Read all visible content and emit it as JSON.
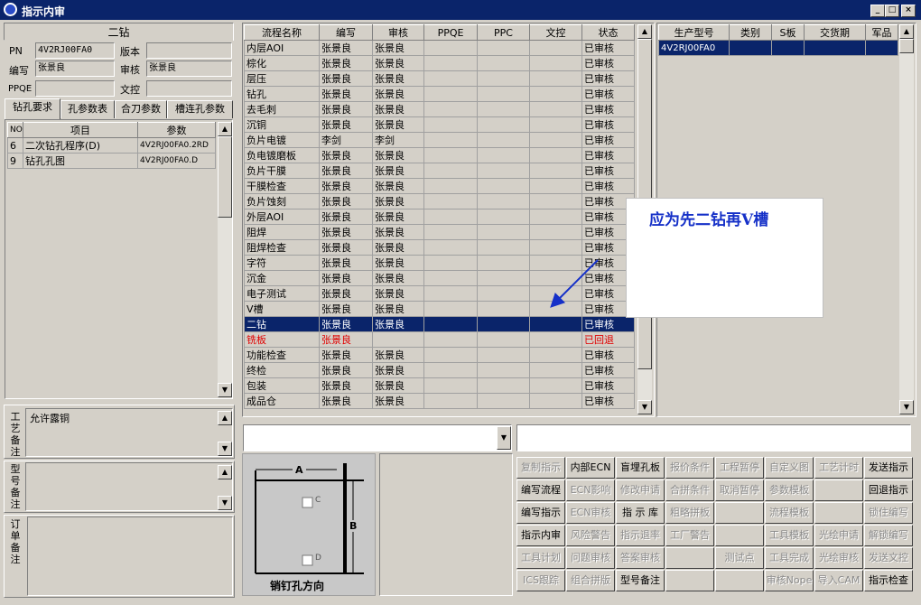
{
  "window": {
    "title": "指示内审",
    "min": "_",
    "max": "□",
    "close": "×"
  },
  "left": {
    "heading": "二钻",
    "pn_label": "PN",
    "pn_value": "4V2RJ00FA0",
    "version_label": "版本",
    "version_value": "",
    "writer_label": "编写",
    "writer_value": "张景良",
    "reviewer_label": "审核",
    "reviewer_value": "张景良",
    "ppqe_label": "PPQE",
    "ppqe_value": "",
    "doc_label": "文控",
    "doc_value": "",
    "tabs": [
      "钻孔要求",
      "孔参数表",
      "合刀参数",
      "槽连孔参数"
    ],
    "drill_table": {
      "headers": [
        "NO",
        "项目",
        "参数"
      ],
      "rows": [
        [
          "6",
          "二次钻孔程序(D)",
          "4V2RJ00FA0.2RD"
        ],
        [
          "9",
          "钻孔孔图",
          "4V2RJ00FA0.D"
        ]
      ]
    },
    "process_note_label": "工艺备注",
    "process_note_value": "允许露铜",
    "model_note_label": "型号备注",
    "order_note_label": "订单备注"
  },
  "flow": {
    "headers": [
      "流程名称",
      "编写",
      "审核",
      "PPQE",
      "PPC",
      "文控",
      "状态"
    ],
    "rows": [
      [
        "内层AOI",
        "张景良",
        "张景良",
        "",
        "",
        "",
        "已审核"
      ],
      [
        "棕化",
        "张景良",
        "张景良",
        "",
        "",
        "",
        "已审核"
      ],
      [
        "层压",
        "张景良",
        "张景良",
        "",
        "",
        "",
        "已审核"
      ],
      [
        "钻孔",
        "张景良",
        "张景良",
        "",
        "",
        "",
        "已审核"
      ],
      [
        "去毛刺",
        "张景良",
        "张景良",
        "",
        "",
        "",
        "已审核"
      ],
      [
        "沉铜",
        "张景良",
        "张景良",
        "",
        "",
        "",
        "已审核"
      ],
      [
        "负片电镀",
        "李剑",
        "李剑",
        "",
        "",
        "",
        "已审核"
      ],
      [
        "负电镀磨板",
        "张景良",
        "张景良",
        "",
        "",
        "",
        "已审核"
      ],
      [
        "负片干膜",
        "张景良",
        "张景良",
        "",
        "",
        "",
        "已审核"
      ],
      [
        "干膜检查",
        "张景良",
        "张景良",
        "",
        "",
        "",
        "已审核"
      ],
      [
        "负片蚀刻",
        "张景良",
        "张景良",
        "",
        "",
        "",
        "已审核"
      ],
      [
        "外层AOI",
        "张景良",
        "张景良",
        "",
        "",
        "",
        "已审核"
      ],
      [
        "阻焊",
        "张景良",
        "张景良",
        "",
        "",
        "",
        "已审核"
      ],
      [
        "阻焊检查",
        "张景良",
        "张景良",
        "",
        "",
        "",
        "已审核"
      ],
      [
        "字符",
        "张景良",
        "张景良",
        "",
        "",
        "",
        "已审核"
      ],
      [
        "沉金",
        "张景良",
        "张景良",
        "",
        "",
        "",
        "已审核"
      ],
      [
        "电子测试",
        "张景良",
        "张景良",
        "",
        "",
        "",
        "已审核"
      ],
      [
        "V槽",
        "张景良",
        "张景良",
        "",
        "",
        "",
        "已审核"
      ],
      [
        "二钻",
        "张景良",
        "张景良",
        "",
        "",
        "",
        "已审核"
      ],
      [
        "铣板",
        "张景良",
        "",
        "",
        "",
        "",
        "已回退"
      ],
      [
        "功能检查",
        "张景良",
        "张景良",
        "",
        "",
        "",
        "已审核"
      ],
      [
        "终检",
        "张景良",
        "张景良",
        "",
        "",
        "",
        "已审核"
      ],
      [
        "包装",
        "张景良",
        "张景良",
        "",
        "",
        "",
        "已审核"
      ],
      [
        "成品仓",
        "张景良",
        "张景良",
        "",
        "",
        "",
        "已审核"
      ]
    ],
    "selected_index": 18,
    "rejected_index": 19
  },
  "production": {
    "headers": [
      "生产型号",
      "类别",
      "S板",
      "交货期",
      "军品"
    ],
    "rows": [
      [
        "4V2RJ00FA0",
        "",
        "",
        "",
        ""
      ]
    ]
  },
  "annotation": {
    "text": "应为先二钻再V槽"
  },
  "diagram": {
    "label_a": "A",
    "label_b": "B",
    "label_c": "C",
    "label_d": "D",
    "caption": "销钉孔方向"
  },
  "buttons": [
    [
      "复制指示",
      "内部ECN",
      "盲埋孔板",
      "报价条件",
      "工程暂停",
      "自定义图",
      "工艺计时",
      "发送指示"
    ],
    [
      "编写流程",
      "ECN影响",
      "修改申请",
      "合拼条件",
      "取消暂停",
      "参数模板",
      "",
      "回退指示"
    ],
    [
      "编写指示",
      "ECN审核",
      "指 示 库",
      "粗略拼板",
      "",
      "流程模板",
      "",
      "锁住编写"
    ],
    [
      "指示内审",
      "风险警告",
      "指示退率",
      "工厂警告",
      "",
      "工具模板",
      "光绘申请",
      "解锁编写"
    ],
    [
      "工具计划",
      "问题审核",
      "答案审核",
      "",
      "测试点",
      "工具完成",
      "光绘审核",
      "发送文控"
    ],
    [
      "ICS跟踪",
      "组合拼版",
      "型号备注",
      "",
      "",
      "审核Nope",
      "导入CAM",
      "指示检查"
    ]
  ],
  "button_enabled": [
    [
      false,
      true,
      true,
      false,
      false,
      false,
      false,
      true
    ],
    [
      true,
      false,
      false,
      false,
      false,
      false,
      false,
      true
    ],
    [
      true,
      false,
      true,
      false,
      false,
      false,
      false,
      false
    ],
    [
      true,
      false,
      false,
      false,
      false,
      false,
      false,
      false
    ],
    [
      false,
      false,
      false,
      false,
      false,
      false,
      false,
      false
    ],
    [
      false,
      false,
      true,
      false,
      false,
      false,
      false,
      true
    ]
  ]
}
